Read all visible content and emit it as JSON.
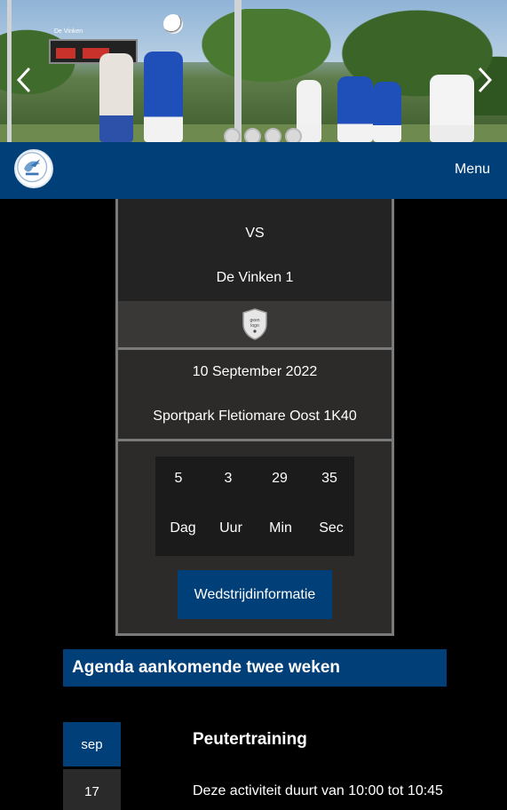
{
  "hero": {
    "scoreboard_label": "De Vinken",
    "slides": [
      "slide-1",
      "slide-2",
      "slide-3",
      "slide-4"
    ],
    "prev_icon": "chevron-left-icon",
    "next_icon": "chevron-right-icon"
  },
  "nav": {
    "menu_label": "Menu",
    "brand_color": "#003f77"
  },
  "match": {
    "vs_label": "VS",
    "opponent": "De Vinken 1",
    "shield_text_line1": "geen",
    "shield_text_line2": "logo",
    "date": "10 September 2022",
    "venue": "Sportpark Fletiomare Oost",
    "venue_code": "1K40",
    "countdown": {
      "days": "5",
      "hours": "3",
      "minutes": "29",
      "seconds": "35",
      "days_label": "Dag",
      "hours_label": "Uur",
      "minutes_label": "Min",
      "seconds_label": "Sec"
    },
    "info_button": "Wedstrijdinformatie"
  },
  "agenda": {
    "heading": "Agenda aankomende twee weken",
    "events": [
      {
        "month": "sep",
        "day": "17",
        "title": "Peutertraining",
        "description": "Deze activiteit duurt van 10:00 tot 10:45"
      }
    ]
  }
}
